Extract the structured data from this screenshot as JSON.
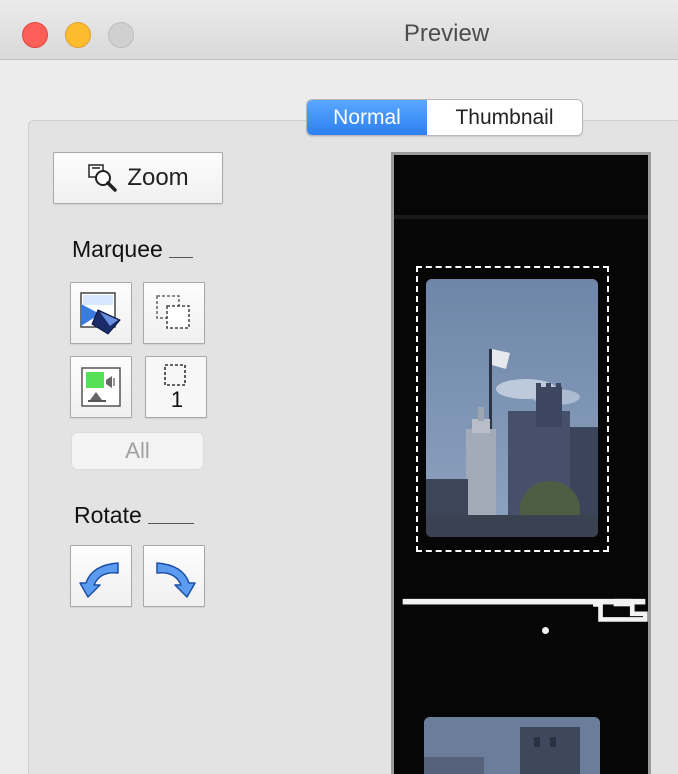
{
  "window": {
    "title": "Preview"
  },
  "tabs": [
    {
      "label": "Normal",
      "selected": true
    },
    {
      "label": "Thumbnail",
      "selected": false
    }
  ],
  "sidebar": {
    "zoom_label": "Zoom",
    "marquee_label": "Marquee",
    "marquee_count": "1",
    "all_label": "All",
    "rotate_label": "Rotate"
  },
  "colors": {
    "close": "#fc5f57",
    "minimize": "#fdbc2e",
    "zoom_disabled": "#d0d0d0",
    "accent": "#2c7ff0"
  },
  "icons": {
    "zoom": "magnifier-icon",
    "auto_crop": "auto-crop-icon",
    "duplicate_marquee": "duplicate-marquee-icon",
    "image_settings": "image-settings-icon",
    "marquee_count": "marquee-count-icon",
    "rotate_left": "rotate-left-icon",
    "rotate_right": "rotate-right-icon"
  }
}
